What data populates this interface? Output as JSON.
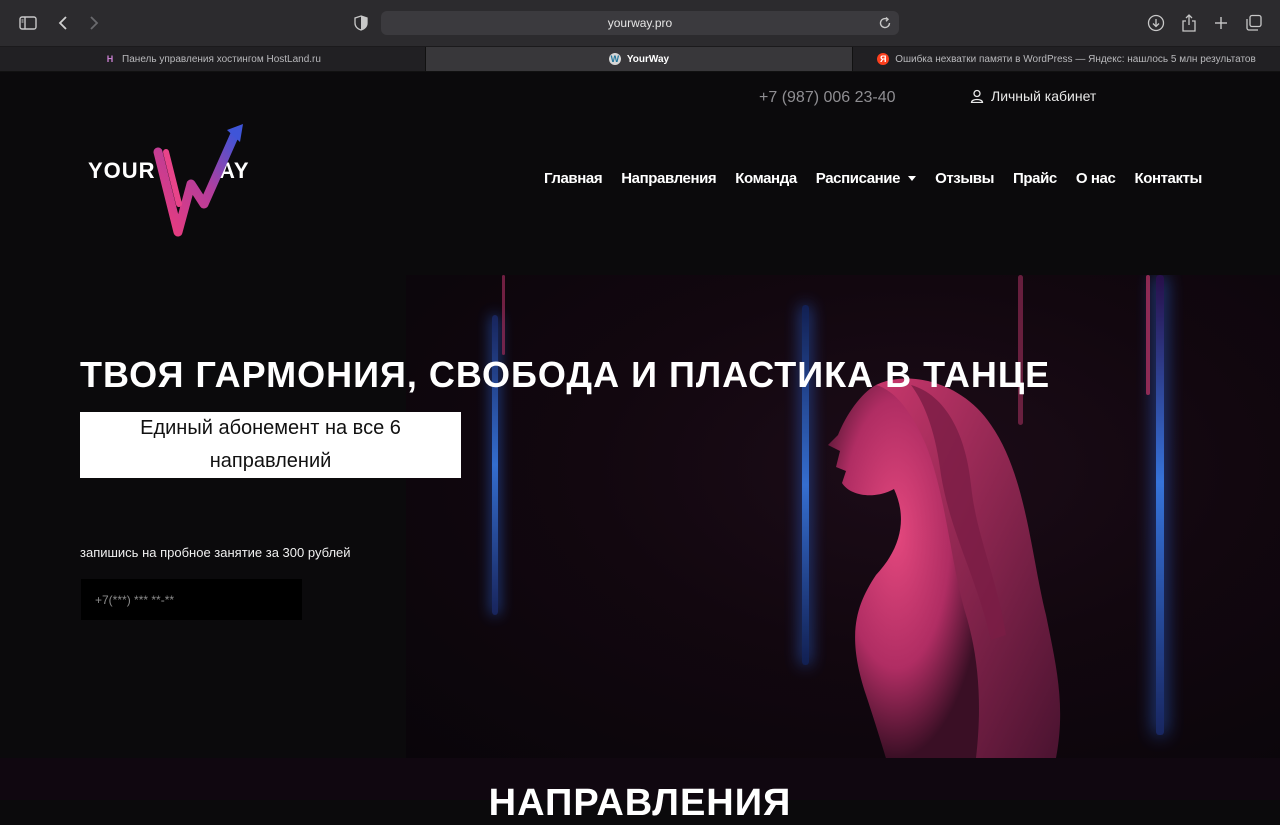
{
  "browser": {
    "url": "yourway.pro",
    "tabs": [
      {
        "label": "Панель управления хостингом HostLand.ru",
        "favicon": "H"
      },
      {
        "label": "YourWay",
        "favicon": "W"
      },
      {
        "label": "Ошибка нехватки памяти в WordPress — Яндекс: нашлось 5 млн результатов",
        "favicon": "Я"
      }
    ]
  },
  "header": {
    "phone": "+7 (987) 006 23-40",
    "account_label": "Личный кабинет",
    "logo": {
      "left": "YOUR",
      "right": "AY"
    },
    "nav": [
      "Главная",
      "Направления",
      "Команда",
      "Расписание",
      "Отзывы",
      "Прайс",
      "О нас",
      "Контакты"
    ]
  },
  "hero": {
    "title": "ТВОЯ ГАРМОНИЯ, СВОБОДА И ПЛАСТИКА В ТАНЦЕ",
    "badge_line1": "Единый абонемент на все 6",
    "badge_line2": "направлений",
    "cta_text": "запишись на пробное занятие за 300 рублей",
    "phone_placeholder": "+7(***) *** **-**"
  },
  "sections": {
    "directions_title": "НАПРАВЛЕНИЯ"
  },
  "colors": {
    "accent_pink": "#e4407c",
    "accent_blue": "#3a59d6",
    "background": "#0b0a0c"
  }
}
